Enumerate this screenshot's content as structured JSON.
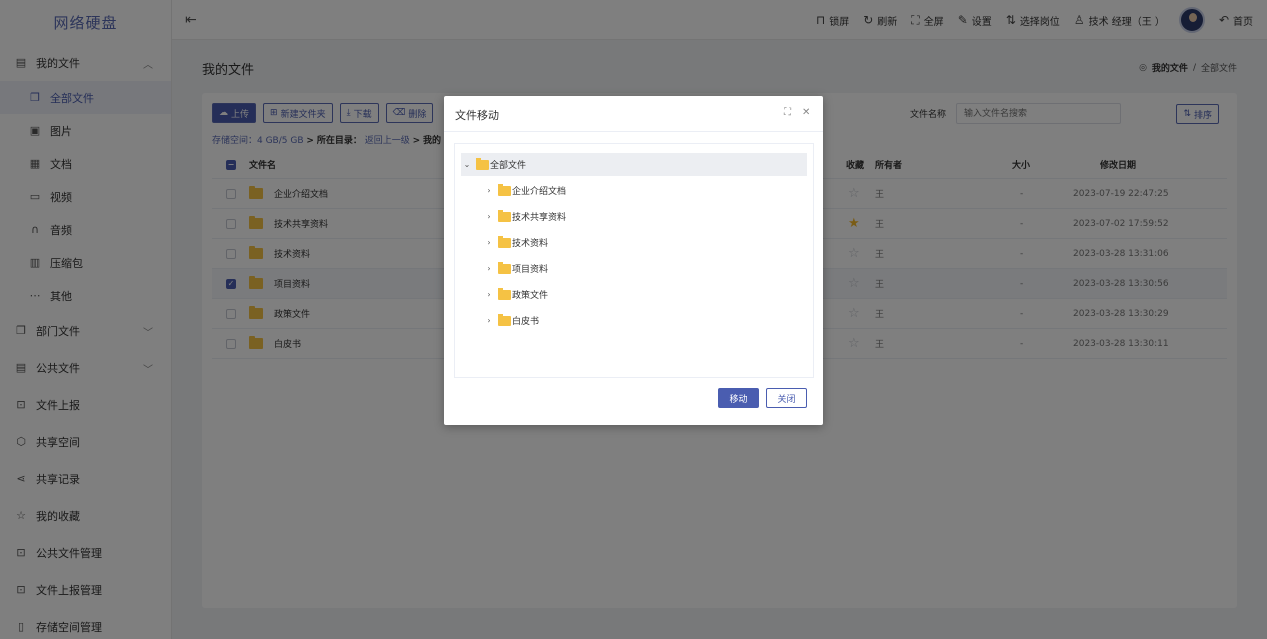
{
  "app": {
    "title": "网络硬盘"
  },
  "topbar": {
    "actions": [
      {
        "icon": "lock-icon",
        "label": "锁屏"
      },
      {
        "icon": "refresh-icon",
        "label": "刷新"
      },
      {
        "icon": "fullscreen-icon",
        "label": "全屏"
      },
      {
        "icon": "settings-icon",
        "label": "设置"
      },
      {
        "icon": "switch-position-icon",
        "label": "选择岗位"
      },
      {
        "icon": "user-icon",
        "label": "技术    经理（王   ）"
      }
    ],
    "home_label": "首页"
  },
  "sidebar": {
    "items": [
      {
        "label": "我的文件",
        "icon": "document-icon"
      },
      {
        "label": "全部文件",
        "icon": "file-copy-icon"
      },
      {
        "label": "图片",
        "icon": "image-icon"
      },
      {
        "label": "文档",
        "icon": "doc-icon"
      },
      {
        "label": "视频",
        "icon": "video-icon"
      },
      {
        "label": "音频",
        "icon": "headphones-icon"
      },
      {
        "label": "压缩包",
        "icon": "archive-icon"
      },
      {
        "label": "其他",
        "icon": "more-icon"
      },
      {
        "label": "部门文件",
        "icon": "department-icon"
      },
      {
        "label": "公共文件",
        "icon": "public-icon"
      },
      {
        "label": "文件上报",
        "icon": "upload-report-icon"
      },
      {
        "label": "共享空间",
        "icon": "cube-icon"
      },
      {
        "label": "共享记录",
        "icon": "share-icon"
      },
      {
        "label": "我的收藏",
        "icon": "star-icon"
      },
      {
        "label": "公共文件管理",
        "icon": "manage-icon"
      },
      {
        "label": "文件上报管理",
        "icon": "manage-icon"
      },
      {
        "label": "存储空间管理",
        "icon": "storage-icon"
      }
    ]
  },
  "page": {
    "title": "我的文件",
    "breadcrumb": {
      "current": "我的文件",
      "separator": "/",
      "sub": "全部文件"
    }
  },
  "toolbar": {
    "upload": "上传",
    "new_folder": "新建文件夹",
    "download": "下载",
    "delete": "删除",
    "search_label": "文件名称",
    "search_placeholder": "输入文件名搜索",
    "sort": "排序"
  },
  "storage": {
    "text": "存储空间：4 GB/5 GB",
    "arrow": ">",
    "dir_label": "所在目录：",
    "back": "返回上一级",
    "arrow2": ">",
    "current": "我的"
  },
  "table": {
    "headers": {
      "name": "文件名",
      "fav": "收藏",
      "owner": "所有者",
      "size": "大小",
      "date": "修改日期"
    },
    "rows": [
      {
        "name": "企业介绍文档",
        "fav": false,
        "checked": false,
        "owner": "王  ",
        "size": "-",
        "date": "2023-07-19 22:47:25"
      },
      {
        "name": "技术共享资料",
        "fav": true,
        "checked": false,
        "owner": "王  ",
        "size": "-",
        "date": "2023-07-02 17:59:52"
      },
      {
        "name": "技术资料",
        "fav": false,
        "checked": false,
        "owner": "王  ",
        "size": "-",
        "date": "2023-03-28 13:31:06"
      },
      {
        "name": "项目资料",
        "fav": false,
        "checked": true,
        "owner": "王  ",
        "size": "-",
        "date": "2023-03-28 13:30:56"
      },
      {
        "name": "政策文件",
        "fav": false,
        "checked": false,
        "owner": "王  ",
        "size": "-",
        "date": "2023-03-28 13:30:29"
      },
      {
        "name": "白皮书",
        "fav": false,
        "checked": false,
        "owner": "王  ",
        "size": "-",
        "date": "2023-03-28 13:30:11"
      }
    ]
  },
  "modal": {
    "title": "文件移动",
    "tree": {
      "root": "全部文件",
      "children": [
        "企业介绍文档",
        "技术共享资料",
        "技术资料",
        "项目资料",
        "政策文件",
        "白皮书"
      ]
    },
    "confirm": "移动",
    "cancel": "关闭"
  },
  "colors": {
    "accent": "#4a5db0",
    "folder": "#f5c244",
    "star_on": "#f5b82a"
  }
}
